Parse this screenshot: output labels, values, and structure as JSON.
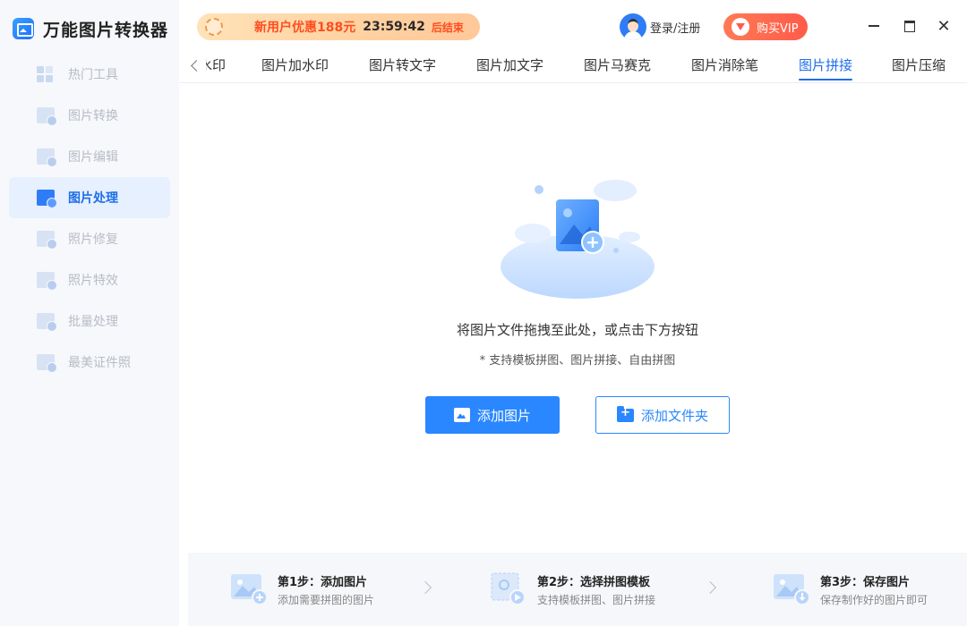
{
  "app": {
    "title": "万能图片转换器"
  },
  "promo": {
    "text": "新用户优惠188元",
    "timer": "23:59:42",
    "end_label": "后结束"
  },
  "header": {
    "login_label": "登录/注册",
    "vip_label": "购买VIP"
  },
  "window": {
    "close_glyph": "✕"
  },
  "sidebar": {
    "items": [
      {
        "label": "热门工具",
        "icon": "grid-icon"
      },
      {
        "label": "图片转换",
        "icon": "image-convert-icon"
      },
      {
        "label": "图片编辑",
        "icon": "image-edit-icon"
      },
      {
        "label": "图片处理",
        "icon": "image-process-icon",
        "active": true
      },
      {
        "label": "照片修复",
        "icon": "photo-repair-icon"
      },
      {
        "label": "照片特效",
        "icon": "photo-effect-icon"
      },
      {
        "label": "批量处理",
        "icon": "batch-icon"
      },
      {
        "label": "最美证件照",
        "icon": "id-photo-icon"
      }
    ]
  },
  "tabs": {
    "items": [
      {
        "label": "水印"
      },
      {
        "label": "图片加水印"
      },
      {
        "label": "图片转文字"
      },
      {
        "label": "图片加文字"
      },
      {
        "label": "图片马赛克"
      },
      {
        "label": "图片消除笔"
      },
      {
        "label": "图片拼接",
        "active": true
      },
      {
        "label": "图片压缩"
      }
    ]
  },
  "main": {
    "drop_text": "将图片文件拖拽至此处，或点击下方按钮",
    "hint": "* 支持模板拼图、图片拼接、自由拼图",
    "add_image_label": "添加图片",
    "add_folder_label": "添加文件夹"
  },
  "steps": [
    {
      "title": "第1步：添加图片",
      "desc": "添加需要拼图的图片"
    },
    {
      "title": "第2步：选择拼图模板",
      "desc": "支持模板拼图、图片拼接"
    },
    {
      "title": "第3步：保存图片",
      "desc": "保存制作好的图片即可"
    }
  ],
  "colors": {
    "accent": "#2a87ff",
    "active_text": "#1e6fe8",
    "promo_red": "#ff4d1f",
    "vip": "#ff5b4a"
  }
}
